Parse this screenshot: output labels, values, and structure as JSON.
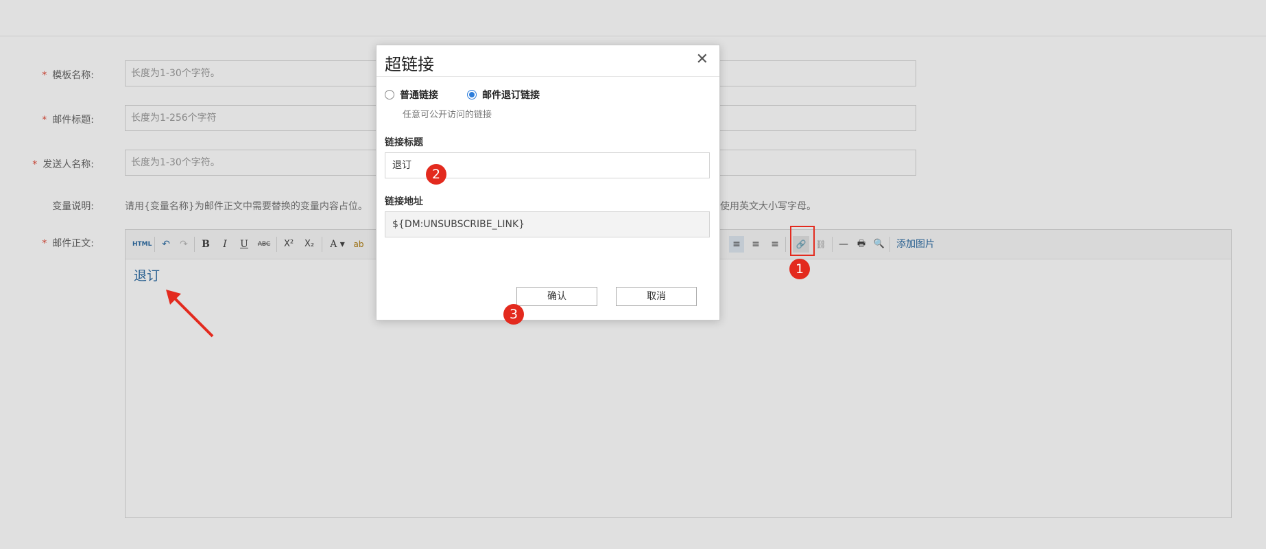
{
  "form": {
    "template_name": {
      "label": "模板名称:",
      "placeholder": "长度为1-30个字符。"
    },
    "mail_subject": {
      "label": "邮件标题:",
      "placeholder": "长度为1-256个字符"
    },
    "sender_name": {
      "label": "发送人名称:",
      "placeholder": "长度为1-30个字符。"
    },
    "variable_note": {
      "label": "变量说明:",
      "text": "请用{变量名称}为邮件正文中需要替换的变量内容占位。",
      "text_tail": "使用英文大小写字母。"
    },
    "mail_body": {
      "label": "邮件正文:",
      "content_link": "退订"
    },
    "required_mark": "*"
  },
  "toolbar": {
    "html": "HTML",
    "undo": "↶",
    "redo": "↷",
    "bold": "B",
    "italic": "I",
    "underline": "U",
    "strike": "ABC",
    "superscript": "X²",
    "subscript": "X₂",
    "font_color": "A ▾",
    "bg_color": "ab",
    "align_left": "≡",
    "align_center": "≡",
    "align_right": "≡",
    "link": "🔗",
    "unlink": "⛓",
    "hr": "—",
    "print": "🖶",
    "preview": "🔍",
    "add_image": "添加图片"
  },
  "dialog": {
    "title": "超链接",
    "close": "✕",
    "radio_normal": "普通链接",
    "radio_unsub": "邮件退订链接",
    "hint": "任意可公开访问的链接",
    "link_title_label": "链接标题",
    "link_title_value": "退订",
    "link_url_label": "链接地址",
    "link_url_value": "${DM:UNSUBSCRIBE_LINK}",
    "confirm": "确认",
    "cancel": "取消"
  },
  "markers": [
    "1",
    "2",
    "3"
  ],
  "colors": {
    "accent": "#2e6da4",
    "marker": "#e32a1e",
    "radio": "#2d7ddb"
  }
}
